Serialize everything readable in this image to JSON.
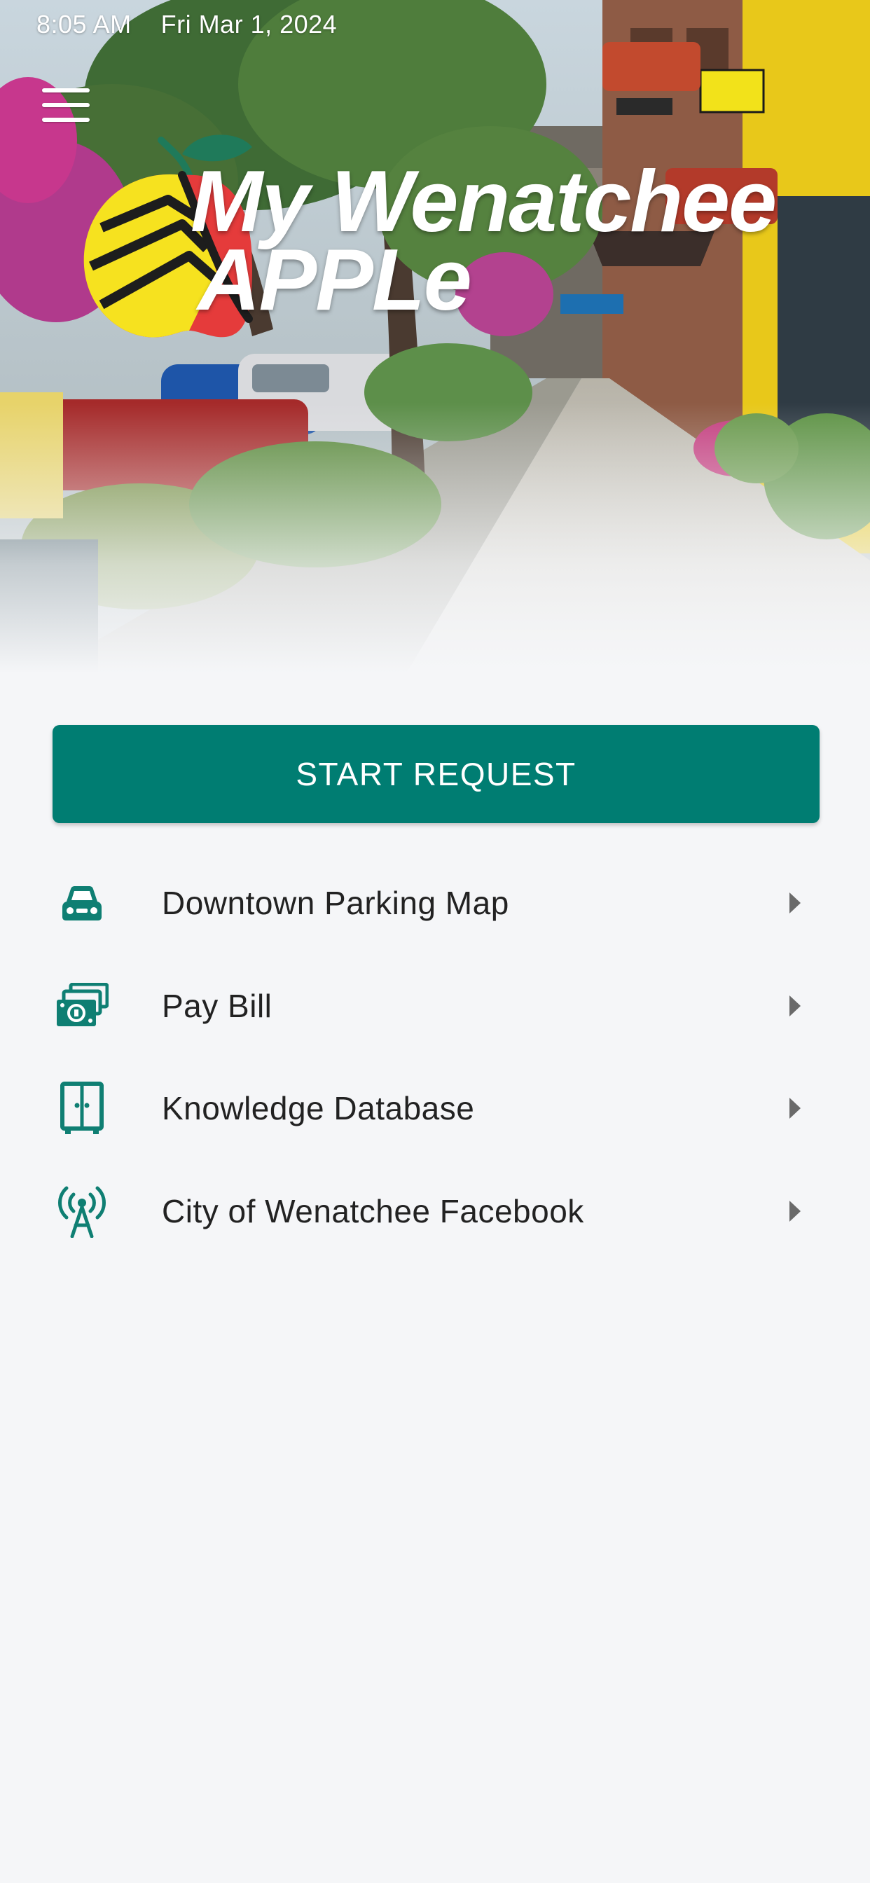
{
  "status_bar": {
    "time": "8:05 AM",
    "date": "Fri Mar 1, 2024"
  },
  "header": {
    "menu_icon": "hamburger-menu-icon",
    "logo_line1": "My Wenatchee",
    "logo_line2": "APPLe",
    "logo_icon": "apple-logo-icon"
  },
  "start_request": {
    "label": "START REQUEST",
    "color": "#007d72"
  },
  "menu": {
    "items": [
      {
        "label": "Downtown Parking Map",
        "icon": "car-icon"
      },
      {
        "label": "Pay Bill",
        "icon": "money-bills-icon"
      },
      {
        "label": "Knowledge Database",
        "icon": "cabinet-icon"
      },
      {
        "label": "City of Wenatchee Facebook",
        "icon": "broadcast-tower-icon"
      }
    ],
    "icon_color": "#0f7f73",
    "chevron_icon": "caret-right-icon"
  },
  "colors": {
    "accent": "#007d72",
    "apple_red": "#e53b3b",
    "apple_yellow": "#f6e21f",
    "leaf_green": "#1f7a5a",
    "background": "#f5f6f8"
  }
}
